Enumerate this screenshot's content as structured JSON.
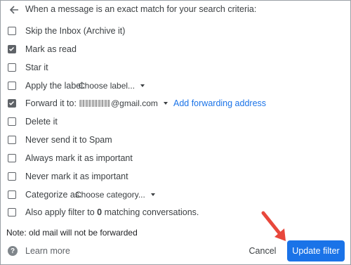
{
  "header": {
    "back_icon": "arrow-left-icon",
    "text": "When a message is an exact match for your search criteria:"
  },
  "options": {
    "skip_inbox": {
      "label": "Skip the Inbox (Archive it)",
      "checked": false
    },
    "mark_read": {
      "label": "Mark as read",
      "checked": true
    },
    "star": {
      "label": "Star it",
      "checked": false
    },
    "apply_label": {
      "label": "Apply the label:",
      "checked": false,
      "select_value": "Choose label..."
    },
    "forward": {
      "label": "Forward it to:",
      "checked": true,
      "email_suffix": "@gmail.com",
      "add_link": "Add forwarding address"
    },
    "delete": {
      "label": "Delete it",
      "checked": false
    },
    "never_spam": {
      "label": "Never send it to Spam",
      "checked": false
    },
    "always_important": {
      "label": "Always mark it as important",
      "checked": false
    },
    "never_important": {
      "label": "Never mark it as important",
      "checked": false
    },
    "categorize": {
      "label": "Categorize as:",
      "checked": false,
      "select_value": "Choose category..."
    },
    "also_apply": {
      "label_prefix": "Also apply filter to",
      "count": "0",
      "label_suffix": "matching conversations.",
      "checked": false
    }
  },
  "note": "Note: old mail will not be forwarded",
  "footer": {
    "help_icon": "question-circle-icon",
    "learn_more": "Learn more",
    "cancel": "Cancel",
    "update": "Update filter",
    "accent_color": "#1a73e8",
    "arrow_color": "#e8473b"
  }
}
